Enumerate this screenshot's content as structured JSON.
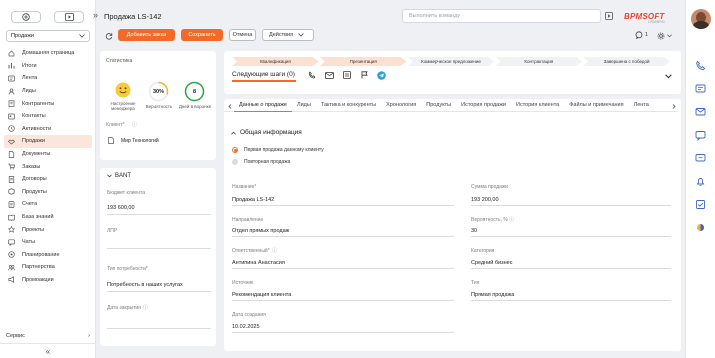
{
  "header": {
    "title": "Продажа LS-142",
    "command_placeholder": "Выполнить команду",
    "logo": "BPMSOFT",
    "logo_sub": "CRM/BPM"
  },
  "sidebar": {
    "workspace": "Продажи",
    "items": [
      {
        "label": "Домашняя страница",
        "icon": "home-icon"
      },
      {
        "label": "Итоги",
        "icon": "chart-icon"
      },
      {
        "label": "Лента",
        "icon": "feed-icon"
      },
      {
        "label": "Лиды",
        "icon": "lead-icon"
      },
      {
        "label": "Контрагенты",
        "icon": "building-icon"
      },
      {
        "label": "Контакты",
        "icon": "contact-icon"
      },
      {
        "label": "Активности",
        "icon": "clock-icon"
      },
      {
        "label": "Продажи",
        "icon": "handshake-icon"
      },
      {
        "label": "Документы",
        "icon": "document-icon"
      },
      {
        "label": "Заказы",
        "icon": "cart-icon"
      },
      {
        "label": "Договоры",
        "icon": "contract-icon"
      },
      {
        "label": "Продукты",
        "icon": "box-icon"
      },
      {
        "label": "Счета",
        "icon": "invoice-icon"
      },
      {
        "label": "База знаний",
        "icon": "book-icon"
      },
      {
        "label": "Проекты",
        "icon": "project-icon"
      },
      {
        "label": "Чаты",
        "icon": "chat-icon"
      },
      {
        "label": "Планирование",
        "icon": "plan-icon"
      },
      {
        "label": "Партнерства",
        "icon": "partner-icon"
      },
      {
        "label": "Промоакции",
        "icon": "promo-icon"
      }
    ],
    "active_index": 7,
    "service": "Сервис"
  },
  "toolbar": {
    "add_order": "Добавить заказ",
    "save": "Сохранить",
    "cancel": "Отмена",
    "actions": "Действия",
    "counter": "1"
  },
  "stats": {
    "title": "Статистика",
    "manager_mood_label": "Настроение менеджера",
    "probability_value": "30%",
    "probability_label": "Вероятность",
    "days_value": "8",
    "days_label": "Дней в воронке",
    "probability_fraction": 0.3,
    "client_label": "Клиент*",
    "client_value": "Мир Технологий"
  },
  "bant": {
    "title": "BANT",
    "budget_label": "Бюджет клиента",
    "budget_value": "193 600,00",
    "lpr_label": "ЛПР",
    "lpr_value": "",
    "need_type_label": "Тип потребности*",
    "need_type_value": "Потребность в наших услугах",
    "close_date_label": "Дата закрытия",
    "close_date_value": ""
  },
  "stages": [
    {
      "label": "Квалификация",
      "done": true
    },
    {
      "label": "Презентация",
      "done": true
    },
    {
      "label": "Коммерческое предложение",
      "done": false
    },
    {
      "label": "Контрактация",
      "done": false
    },
    {
      "label": "Завершена с победой",
      "done": false
    }
  ],
  "next_steps": {
    "label": "Следующие шаги (0)"
  },
  "tabs": [
    "Данные о продаже",
    "Лиды",
    "Тактика и конкуренты",
    "Хронология",
    "Продукты",
    "История продажи",
    "История клиента",
    "Файлы и примечания",
    "Лента"
  ],
  "active_tab": 0,
  "general": {
    "title": "Общая информация",
    "radio_first": "Первая продажа данному клиенту",
    "radio_repeat": "Повторная продажа",
    "fields": {
      "name_label": "Название*",
      "name_value": "Продажа LS-142",
      "direction_label": "Направление",
      "direction_value": "Отдел прямых продаж",
      "responsible_label": "Ответственный*",
      "responsible_value": "Антипина Анастасия",
      "source_label": "Источник",
      "source_value": "Рекомендация клиента",
      "created_label": "Дата создания",
      "created_value": "10.02.2025",
      "amount_label": "Сумма продажи",
      "amount_value": "193 200,00",
      "probability_label": "Вероятность, %",
      "probability_value": "30",
      "category_label": "Категория",
      "category_value": "Средний бизнес",
      "type_label": "Тип",
      "type_value": "Прямая продажа"
    }
  },
  "colors": {
    "accent": "#f06a28",
    "stage_done": "#fde0cf",
    "stage_todo": "#f1f2f4",
    "probability_ring": "#f2b233",
    "days_ring": "#27a745"
  }
}
